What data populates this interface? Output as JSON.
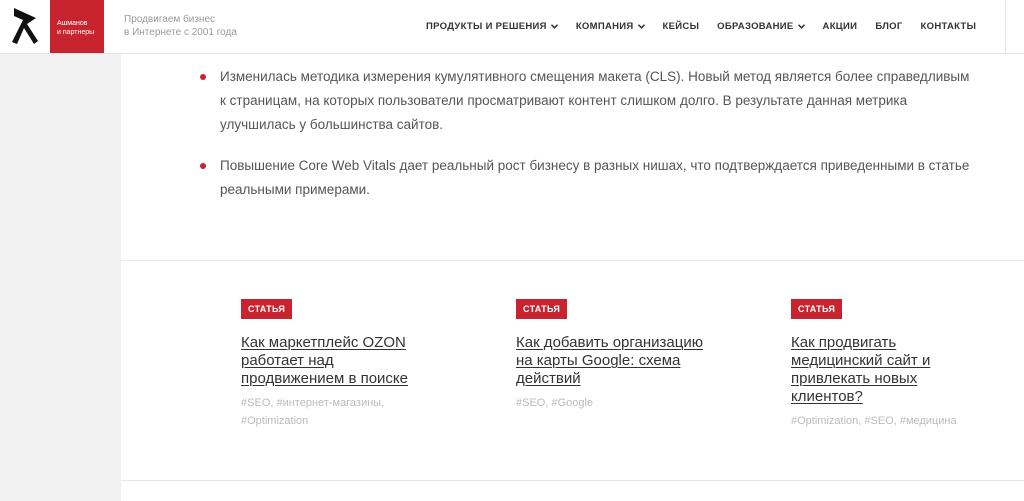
{
  "brand": {
    "logo_line1": "Ашманов",
    "logo_line2": "и партнеры",
    "tagline_line1": "Продвигаем бизнес",
    "tagline_line2": "в Интернете с 2001 года",
    "accent_color": "#c8242f"
  },
  "nav": [
    {
      "label": "ПРОДУКТЫ И РЕШЕНИЯ",
      "dropdown": true
    },
    {
      "label": "КОМПАНИЯ",
      "dropdown": true
    },
    {
      "label": "КЕЙСЫ",
      "dropdown": false
    },
    {
      "label": "ОБРАЗОВАНИЕ",
      "dropdown": true
    },
    {
      "label": "АКЦИИ",
      "dropdown": false
    },
    {
      "label": "БЛОГ",
      "dropdown": false
    },
    {
      "label": "КОНТАКТЫ",
      "dropdown": false
    }
  ],
  "bullets": [
    "Изменилась методика измерения кумулятивного смещения макета (CLS). Новый метод является более справедливым к страницам, на которых пользователи просматривают контент слишком долго. В результате данная метрика улучшилась у большинства сайтов.",
    "Повышение Core Web Vitals дает реальный рост бизнесу в разных нишах, что подтверждается приведенными в статье реальными примерами."
  ],
  "cards": [
    {
      "badge": "СТАТЬЯ",
      "title": "Как маркетплейс OZON работает над продвижением в поиске",
      "tags": "#SEO, #интернет-магазины, #Optimization"
    },
    {
      "badge": "СТАТЬЯ",
      "title": "Как добавить организацию на карты Google: схема действий",
      "tags": "#SEO, #Google"
    },
    {
      "badge": "СТАТЬЯ",
      "title": "Как продвигать медицинский сайт и привлекать новых клиентов?",
      "tags": "#Optimization, #SEO, #медицина"
    }
  ]
}
